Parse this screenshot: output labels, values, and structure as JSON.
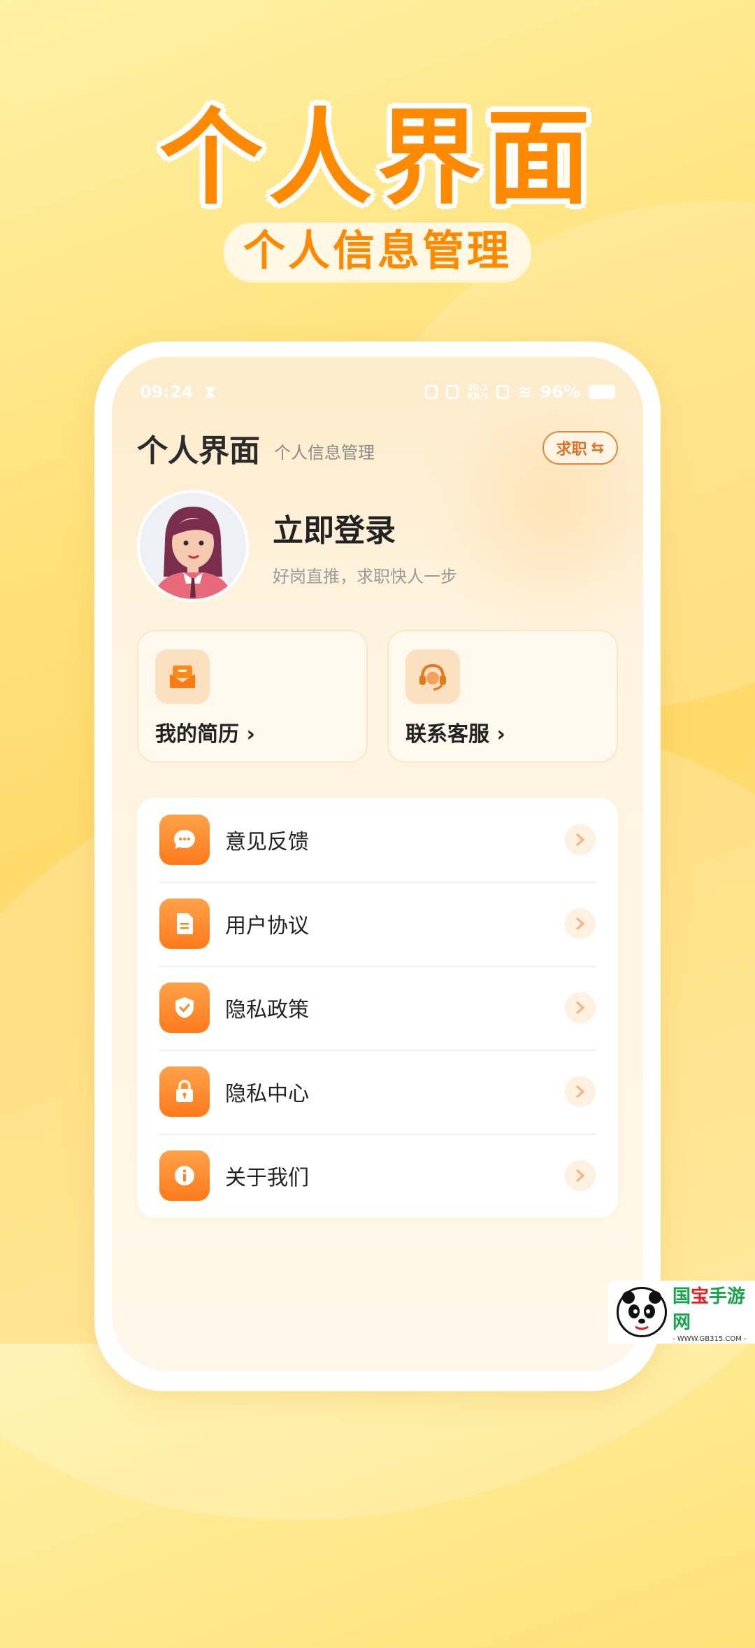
{
  "hero": {
    "title": "个人界面",
    "subtitle": "个人信息管理"
  },
  "status_bar": {
    "time": "09:24",
    "net_speed_top": "20.1",
    "net_speed_bottom": "KB/s",
    "battery": "96%"
  },
  "header": {
    "title": "个人界面",
    "subtitle": "个人信息管理",
    "switch_label": "求职",
    "switch_icon": "swap-arrows-icon"
  },
  "profile": {
    "title": "立即登录",
    "subtitle": "好岗直推，求职快人一步"
  },
  "cards": [
    {
      "label": "我的简历 ›",
      "icon": "resume-icon"
    },
    {
      "label": "联系客服 ›",
      "icon": "headset-icon"
    }
  ],
  "menu": [
    {
      "label": "意见反馈",
      "icon": "chat-bubble-icon"
    },
    {
      "label": "用户协议",
      "icon": "document-icon"
    },
    {
      "label": "隐私政策",
      "icon": "shield-check-icon"
    },
    {
      "label": "隐私中心",
      "icon": "lock-icon"
    },
    {
      "label": "关于我们",
      "icon": "info-icon"
    }
  ],
  "watermark": {
    "brand_a": "国",
    "brand_b": "宝",
    "brand_c": "手游网",
    "url": "- WWW.GB315.COM -"
  },
  "colors": {
    "accent": "#ff8a00",
    "icon_gradient_top": "#ffa24a",
    "icon_gradient_bottom": "#ff7a1a"
  }
}
